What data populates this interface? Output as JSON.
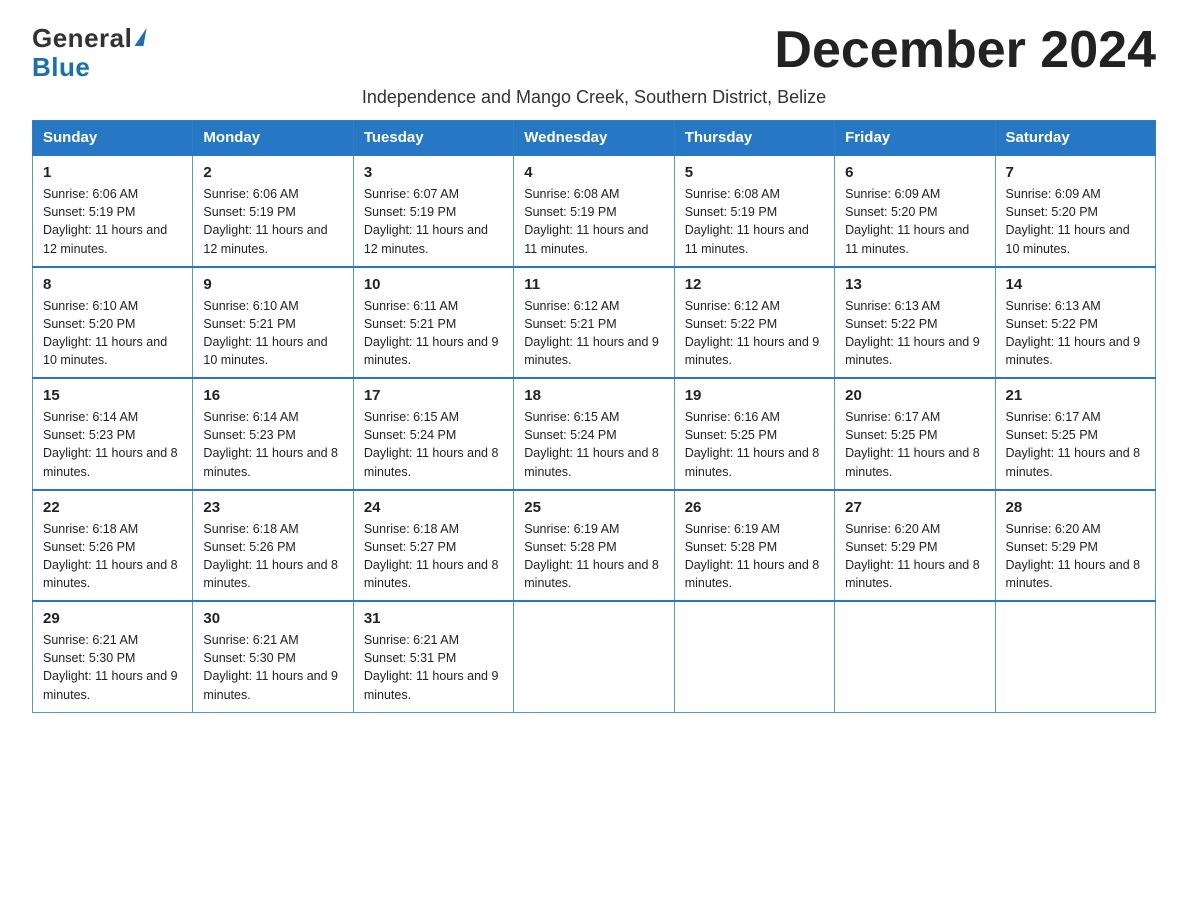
{
  "logo": {
    "general": "General",
    "blue": "Blue",
    "triangle": "▶"
  },
  "title": "December 2024",
  "subtitle": "Independence and Mango Creek, Southern District, Belize",
  "days_of_week": [
    "Sunday",
    "Monday",
    "Tuesday",
    "Wednesday",
    "Thursday",
    "Friday",
    "Saturday"
  ],
  "weeks": [
    [
      {
        "day": "1",
        "sunrise": "6:06 AM",
        "sunset": "5:19 PM",
        "daylight": "11 hours and 12 minutes."
      },
      {
        "day": "2",
        "sunrise": "6:06 AM",
        "sunset": "5:19 PM",
        "daylight": "11 hours and 12 minutes."
      },
      {
        "day": "3",
        "sunrise": "6:07 AM",
        "sunset": "5:19 PM",
        "daylight": "11 hours and 12 minutes."
      },
      {
        "day": "4",
        "sunrise": "6:08 AM",
        "sunset": "5:19 PM",
        "daylight": "11 hours and 11 minutes."
      },
      {
        "day": "5",
        "sunrise": "6:08 AM",
        "sunset": "5:19 PM",
        "daylight": "11 hours and 11 minutes."
      },
      {
        "day": "6",
        "sunrise": "6:09 AM",
        "sunset": "5:20 PM",
        "daylight": "11 hours and 11 minutes."
      },
      {
        "day": "7",
        "sunrise": "6:09 AM",
        "sunset": "5:20 PM",
        "daylight": "11 hours and 10 minutes."
      }
    ],
    [
      {
        "day": "8",
        "sunrise": "6:10 AM",
        "sunset": "5:20 PM",
        "daylight": "11 hours and 10 minutes."
      },
      {
        "day": "9",
        "sunrise": "6:10 AM",
        "sunset": "5:21 PM",
        "daylight": "11 hours and 10 minutes."
      },
      {
        "day": "10",
        "sunrise": "6:11 AM",
        "sunset": "5:21 PM",
        "daylight": "11 hours and 9 minutes."
      },
      {
        "day": "11",
        "sunrise": "6:12 AM",
        "sunset": "5:21 PM",
        "daylight": "11 hours and 9 minutes."
      },
      {
        "day": "12",
        "sunrise": "6:12 AM",
        "sunset": "5:22 PM",
        "daylight": "11 hours and 9 minutes."
      },
      {
        "day": "13",
        "sunrise": "6:13 AM",
        "sunset": "5:22 PM",
        "daylight": "11 hours and 9 minutes."
      },
      {
        "day": "14",
        "sunrise": "6:13 AM",
        "sunset": "5:22 PM",
        "daylight": "11 hours and 9 minutes."
      }
    ],
    [
      {
        "day": "15",
        "sunrise": "6:14 AM",
        "sunset": "5:23 PM",
        "daylight": "11 hours and 8 minutes."
      },
      {
        "day": "16",
        "sunrise": "6:14 AM",
        "sunset": "5:23 PM",
        "daylight": "11 hours and 8 minutes."
      },
      {
        "day": "17",
        "sunrise": "6:15 AM",
        "sunset": "5:24 PM",
        "daylight": "11 hours and 8 minutes."
      },
      {
        "day": "18",
        "sunrise": "6:15 AM",
        "sunset": "5:24 PM",
        "daylight": "11 hours and 8 minutes."
      },
      {
        "day": "19",
        "sunrise": "6:16 AM",
        "sunset": "5:25 PM",
        "daylight": "11 hours and 8 minutes."
      },
      {
        "day": "20",
        "sunrise": "6:17 AM",
        "sunset": "5:25 PM",
        "daylight": "11 hours and 8 minutes."
      },
      {
        "day": "21",
        "sunrise": "6:17 AM",
        "sunset": "5:25 PM",
        "daylight": "11 hours and 8 minutes."
      }
    ],
    [
      {
        "day": "22",
        "sunrise": "6:18 AM",
        "sunset": "5:26 PM",
        "daylight": "11 hours and 8 minutes."
      },
      {
        "day": "23",
        "sunrise": "6:18 AM",
        "sunset": "5:26 PM",
        "daylight": "11 hours and 8 minutes."
      },
      {
        "day": "24",
        "sunrise": "6:18 AM",
        "sunset": "5:27 PM",
        "daylight": "11 hours and 8 minutes."
      },
      {
        "day": "25",
        "sunrise": "6:19 AM",
        "sunset": "5:28 PM",
        "daylight": "11 hours and 8 minutes."
      },
      {
        "day": "26",
        "sunrise": "6:19 AM",
        "sunset": "5:28 PM",
        "daylight": "11 hours and 8 minutes."
      },
      {
        "day": "27",
        "sunrise": "6:20 AM",
        "sunset": "5:29 PM",
        "daylight": "11 hours and 8 minutes."
      },
      {
        "day": "28",
        "sunrise": "6:20 AM",
        "sunset": "5:29 PM",
        "daylight": "11 hours and 8 minutes."
      }
    ],
    [
      {
        "day": "29",
        "sunrise": "6:21 AM",
        "sunset": "5:30 PM",
        "daylight": "11 hours and 9 minutes."
      },
      {
        "day": "30",
        "sunrise": "6:21 AM",
        "sunset": "5:30 PM",
        "daylight": "11 hours and 9 minutes."
      },
      {
        "day": "31",
        "sunrise": "6:21 AM",
        "sunset": "5:31 PM",
        "daylight": "11 hours and 9 minutes."
      },
      null,
      null,
      null,
      null
    ]
  ]
}
